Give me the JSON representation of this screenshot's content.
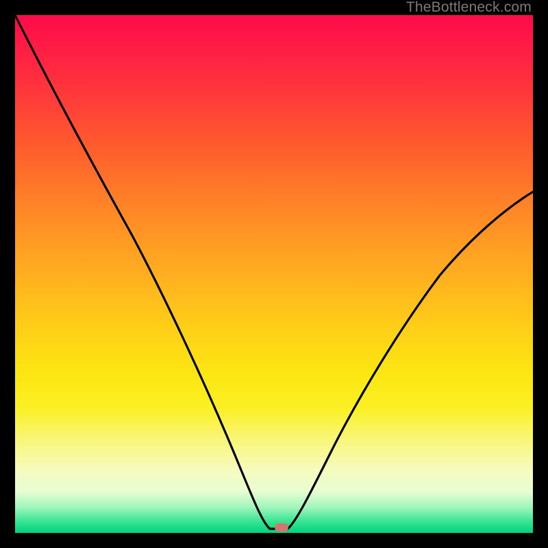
{
  "watermark": "TheBottleneck.com",
  "marker": {
    "x_pct": 51.5,
    "y_pct": 99.0,
    "color": "#d9736f"
  },
  "chart_data": {
    "type": "line",
    "title": "",
    "xlabel": "",
    "ylabel": "",
    "xlim": [
      0,
      100
    ],
    "ylim": [
      0,
      100
    ],
    "grid": false,
    "legend": false,
    "background_gradient": {
      "orientation": "vertical",
      "stops": [
        {
          "pct": 0,
          "color": "#ff0a4a"
        },
        {
          "pct": 25,
          "color": "#ff5a2e"
        },
        {
          "pct": 50,
          "color": "#ffb01f"
        },
        {
          "pct": 70,
          "color": "#fce812"
        },
        {
          "pct": 85,
          "color": "#f7f9a0"
        },
        {
          "pct": 95,
          "color": "#a0f6bd"
        },
        {
          "pct": 100,
          "color": "#00d27c"
        }
      ]
    },
    "series": [
      {
        "name": "bottleneck-curve",
        "color": "#000000",
        "x": [
          0,
          4,
          8,
          12,
          16,
          20,
          24,
          28,
          32,
          36,
          40,
          44,
          47,
          49,
          51,
          53,
          56,
          60,
          65,
          70,
          75,
          80,
          85,
          90,
          95,
          100
        ],
        "y": [
          100,
          92,
          84,
          76,
          69,
          61,
          53,
          43,
          33,
          24,
          15,
          6,
          1,
          0,
          0,
          1,
          6,
          13,
          21,
          29,
          36,
          43,
          49,
          55,
          60,
          65
        ]
      }
    ],
    "marker_point": {
      "x": 51.5,
      "y": 0,
      "color": "#d9736f"
    }
  }
}
